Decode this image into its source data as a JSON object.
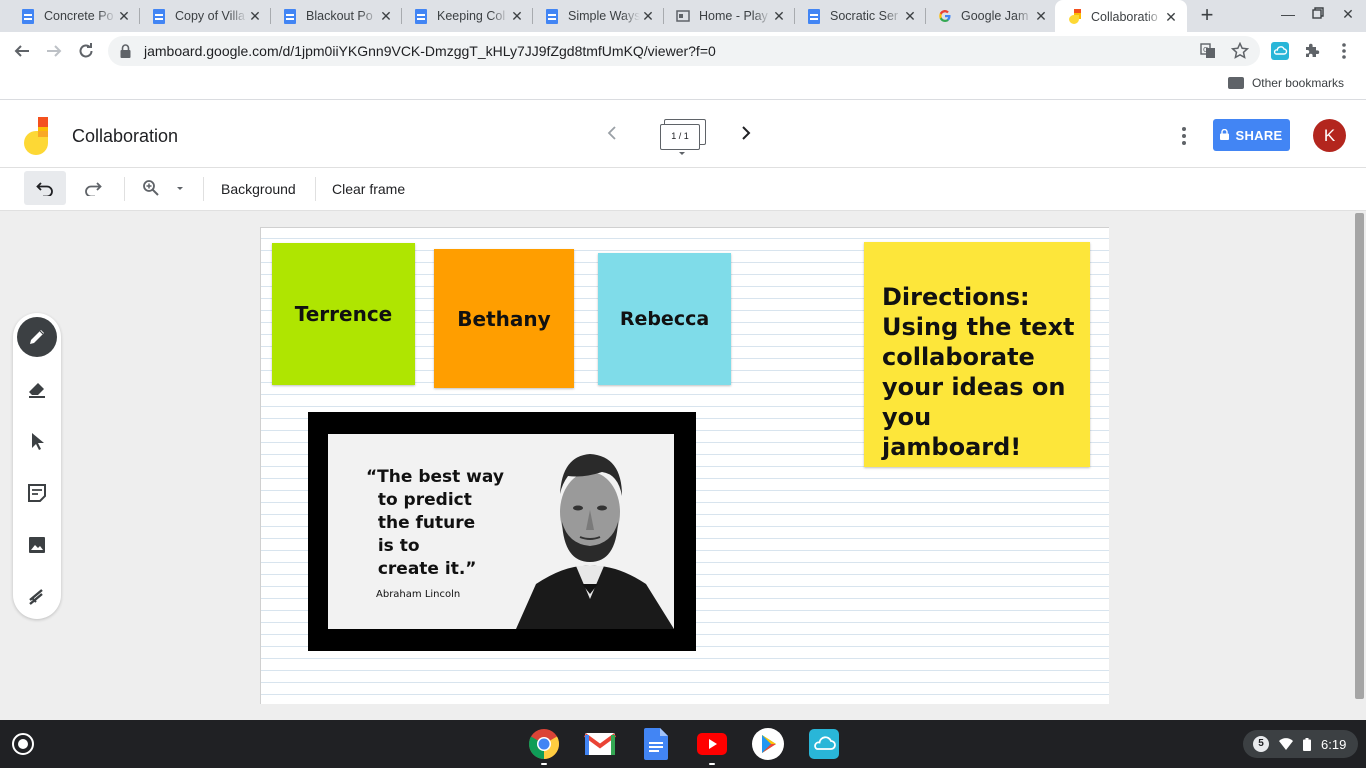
{
  "browser": {
    "tabs": [
      {
        "title": "Concrete Po",
        "favicon": "docs-icon"
      },
      {
        "title": "Copy of Villa",
        "favicon": "docs-icon"
      },
      {
        "title": "Blackout Po",
        "favicon": "docs-icon"
      },
      {
        "title": "Keeping Col",
        "favicon": "docs-icon"
      },
      {
        "title": "Simple Ways",
        "favicon": "docs-icon"
      },
      {
        "title": "Home - Play",
        "favicon": "sites-icon"
      },
      {
        "title": "Socratic Ser",
        "favicon": "docs-icon"
      },
      {
        "title": "Google Jam",
        "favicon": "google-icon"
      },
      {
        "title": "Collaboratio",
        "favicon": "jamboard-icon",
        "active": true
      }
    ],
    "url": "jamboard.google.com/d/1jpm0iiYKGnn9VCK-DmzggT_kHLy7JJ9fZgd8tmfUmKQ/viewer?f=0",
    "other_bookmarks": "Other bookmarks"
  },
  "jamboard": {
    "title": "Collaboration",
    "frame_indicator": "1 / 1",
    "share_label": "SHARE",
    "avatar_initial": "K",
    "toolbar": {
      "background_label": "Background",
      "clear_frame_label": "Clear frame"
    },
    "sticky_notes": [
      {
        "text": "Terrence",
        "color": "#afe501"
      },
      {
        "text": "Bethany",
        "color": "#ff9e00"
      },
      {
        "text": "Rebecca",
        "color": "#7fdce9"
      },
      {
        "text": "Directions: Using the text collaborate your ideas on you jamboard!",
        "color": "#fde63a"
      }
    ],
    "quote_image": {
      "quote": "“The best way\n  to predict\n  the future\n  is to\n  create it.”",
      "author": "Abraham Lincoln"
    },
    "side_tools": [
      "pen-icon",
      "eraser-icon",
      "select-icon",
      "sticky-note-icon",
      "image-icon",
      "laser-icon"
    ]
  },
  "shelf": {
    "apps": [
      "chrome-icon",
      "gmail-icon",
      "docs-icon",
      "youtube-icon",
      "play-store-icon",
      "cloud-app-icon"
    ],
    "notification_count": "5",
    "time": "6:19"
  },
  "colors": {
    "accent": "#4285f4",
    "avatar": "#b3261e"
  }
}
